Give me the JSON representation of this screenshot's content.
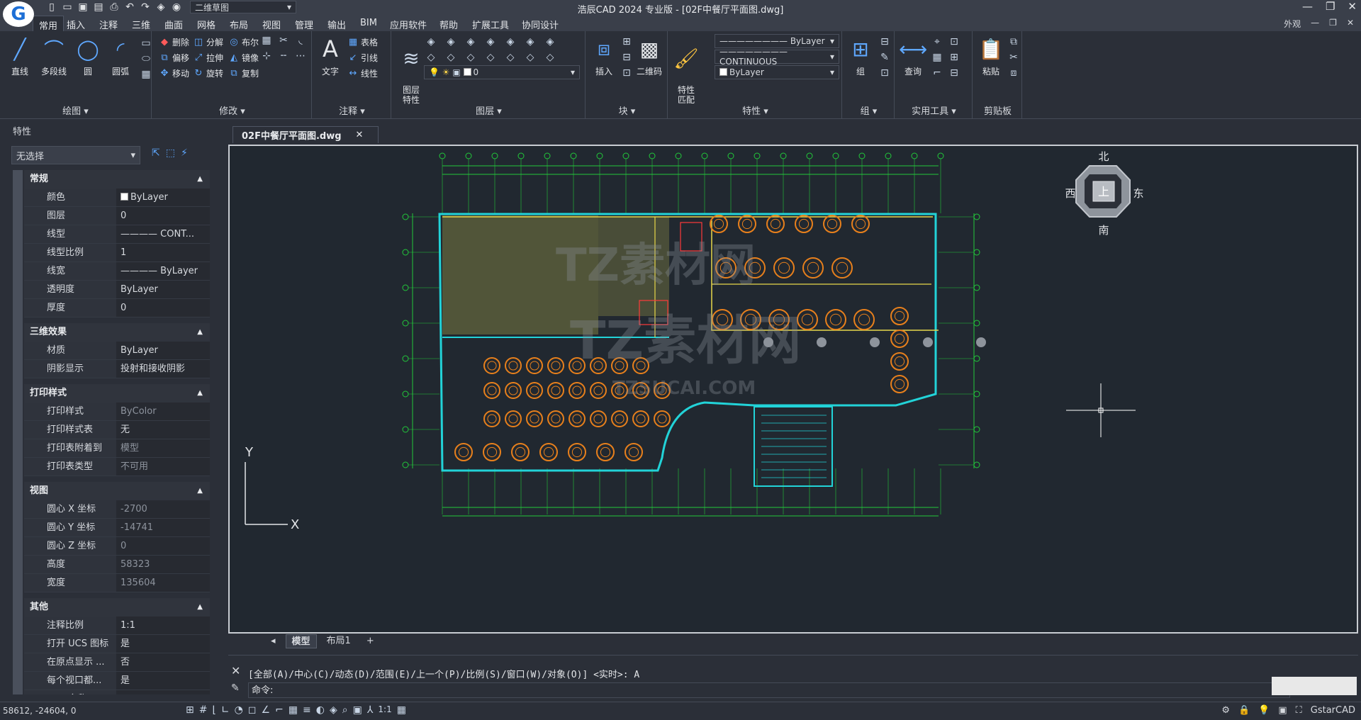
{
  "title_bar": {
    "window_title": "浩辰CAD 2024 专业版 - [02F中餐厅平面图.dwg]",
    "workspace": "二维草图"
  },
  "ribbon_tabs": [
    "常用",
    "插入",
    "注释",
    "三维",
    "曲面",
    "网格",
    "布局",
    "视图",
    "管理",
    "输出",
    "BIM",
    "应用软件",
    "帮助",
    "扩展工具",
    "协同设计"
  ],
  "ribbon_right": {
    "appearance": "外观"
  },
  "panels": {
    "draw": {
      "title": "绘图",
      "buttons": [
        "直线",
        "多段线",
        "圆",
        "圆弧"
      ]
    },
    "modify": {
      "title": "修改",
      "buttons": [
        "删除",
        "分解",
        "布尔",
        "偏移",
        "拉伸",
        "镜像",
        "移动",
        "旋转",
        "复制"
      ]
    },
    "annotation": {
      "title": "注释",
      "text_button": "文字",
      "buttons": [
        "表格",
        "引线",
        "线性"
      ]
    },
    "layer": {
      "title": "图层",
      "layer_prop_button": "图层\n特性",
      "current_layer": "0"
    },
    "block": {
      "title": "块",
      "buttons": [
        "插入",
        "二维码"
      ]
    },
    "properties": {
      "title": "特性",
      "match_button": "特性\n匹配",
      "linetype_top": "ByLayer",
      "linetype": "CONTINUOUS",
      "color": "ByLayer"
    },
    "group": {
      "title": "组",
      "button": "组"
    },
    "utilities": {
      "title": "实用工具",
      "button": "查询"
    },
    "clipboard": {
      "title": "剪贴板",
      "button": "粘贴"
    }
  },
  "properties_palette": {
    "header": "特性",
    "selection": "无选择",
    "groups": [
      {
        "name": "常规",
        "rows": [
          {
            "label": "颜色",
            "value": "ByLayer",
            "swatch": true
          },
          {
            "label": "图层",
            "value": "0"
          },
          {
            "label": "线型",
            "value": "———— CONT..."
          },
          {
            "label": "线型比例",
            "value": "1"
          },
          {
            "label": "线宽",
            "value": "———— ByLayer"
          },
          {
            "label": "透明度",
            "value": "ByLayer"
          },
          {
            "label": "厚度",
            "value": "0"
          }
        ]
      },
      {
        "name": "三维效果",
        "rows": [
          {
            "label": "材质",
            "value": "ByLayer"
          },
          {
            "label": "阴影显示",
            "value": "投射和接收阴影"
          }
        ]
      },
      {
        "name": "打印样式",
        "rows": [
          {
            "label": "打印样式",
            "value": "ByColor",
            "dim": true
          },
          {
            "label": "打印样式表",
            "value": "无"
          },
          {
            "label": "打印表附着到",
            "value": "模型",
            "dim": true
          },
          {
            "label": "打印表类型",
            "value": "不可用",
            "dim": true
          }
        ]
      },
      {
        "name": "视图",
        "rows": [
          {
            "label": "圆心 X 坐标",
            "value": "-2700",
            "dim": true
          },
          {
            "label": "圆心 Y 坐标",
            "value": "-14741",
            "dim": true
          },
          {
            "label": "圆心 Z 坐标",
            "value": "0",
            "dim": true
          },
          {
            "label": "高度",
            "value": "58323",
            "dim": true
          },
          {
            "label": "宽度",
            "value": "135604",
            "dim": true
          }
        ]
      },
      {
        "name": "其他",
        "rows": [
          {
            "label": "注释比例",
            "value": "1:1"
          },
          {
            "label": "打开 UCS 图标",
            "value": "是"
          },
          {
            "label": "在原点显示 ...",
            "value": "否"
          },
          {
            "label": "每个视口都...",
            "value": "是"
          },
          {
            "label": "UCS 名称",
            "value": ""
          }
        ]
      }
    ]
  },
  "document_tab": {
    "name": "02F中餐厅平面图.dwg"
  },
  "viewcube": {
    "north": "北",
    "south": "南",
    "east": "东",
    "west": "西",
    "top": "上"
  },
  "ucs": {
    "x": "X",
    "y": "Y"
  },
  "watermark": {
    "text1": "TZ素材网",
    "text2": "TZSUCAI.COM"
  },
  "layout_tabs": [
    "模型",
    "布局1",
    "+"
  ],
  "command_line": {
    "history": "[全部(A)/中心(C)/动态(D)/范围(E)/上一个(P)/比例(S)/窗口(W)/对象(O)] <实时>: A",
    "prompt": "命令:"
  },
  "status_bar": {
    "coordinates": "58612, -24604, 0",
    "scale": "1:1",
    "app_name": "GstarCAD"
  },
  "colors": {
    "canvas_bg": "#212830",
    "wall": "#22d3d8",
    "dimension": "#22c93a",
    "furniture": "#e8801c",
    "hatch": "#7a7a42",
    "yellow": "#e8d84a"
  }
}
